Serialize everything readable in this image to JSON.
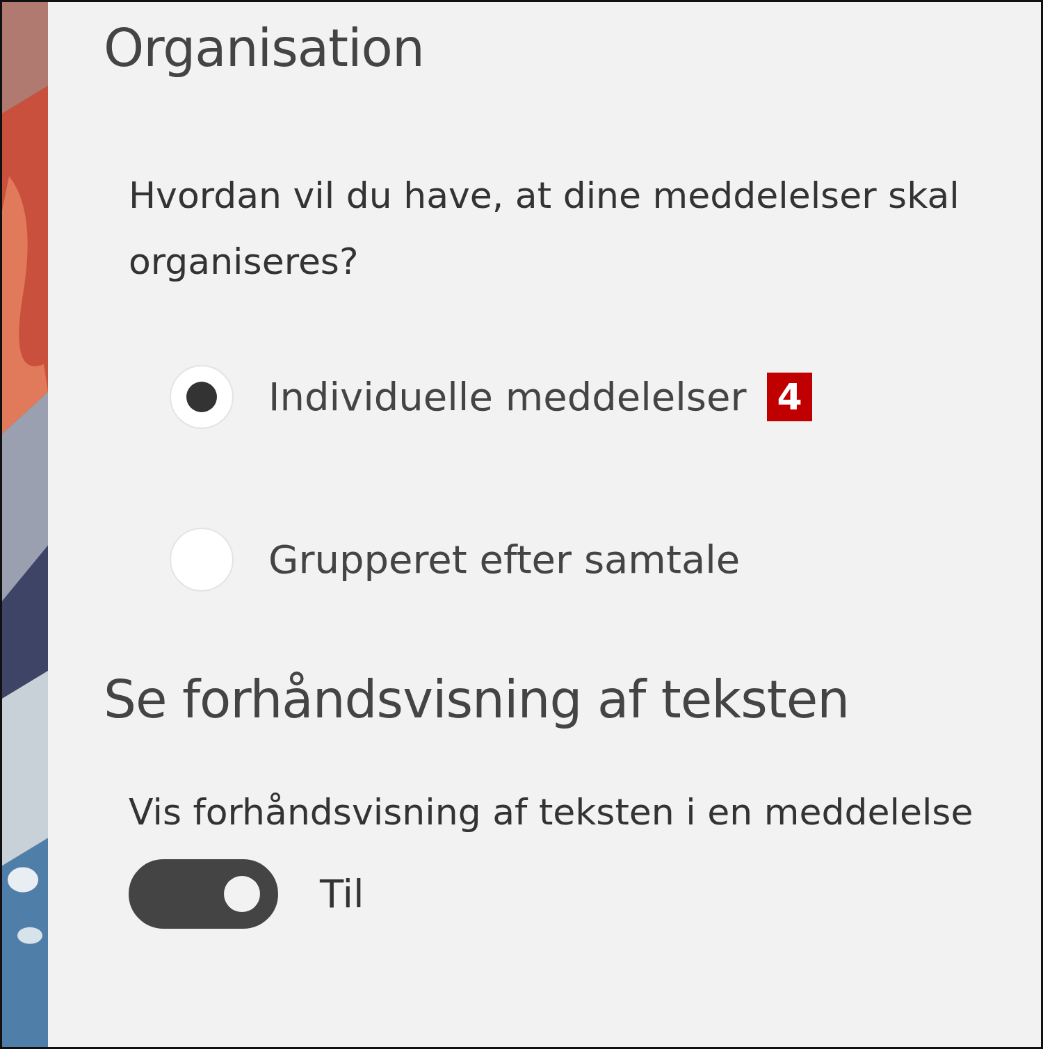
{
  "sections": [
    {
      "kind": "radio-group",
      "title": "Organisation",
      "question": "Hvordan vil du have, at dine meddelelser skal organiseres?",
      "options": [
        {
          "label": "Individuelle meddelelser",
          "badge": "4",
          "selected": true
        },
        {
          "label": "Grupperet efter samtale",
          "selected": false
        }
      ]
    },
    {
      "kind": "toggle",
      "title": "Se forhåndsvisning af teksten",
      "description": "Vis forhåndsvisning af teksten i en meddelelse",
      "toggle": {
        "on": true,
        "label": "Til"
      }
    }
  ]
}
